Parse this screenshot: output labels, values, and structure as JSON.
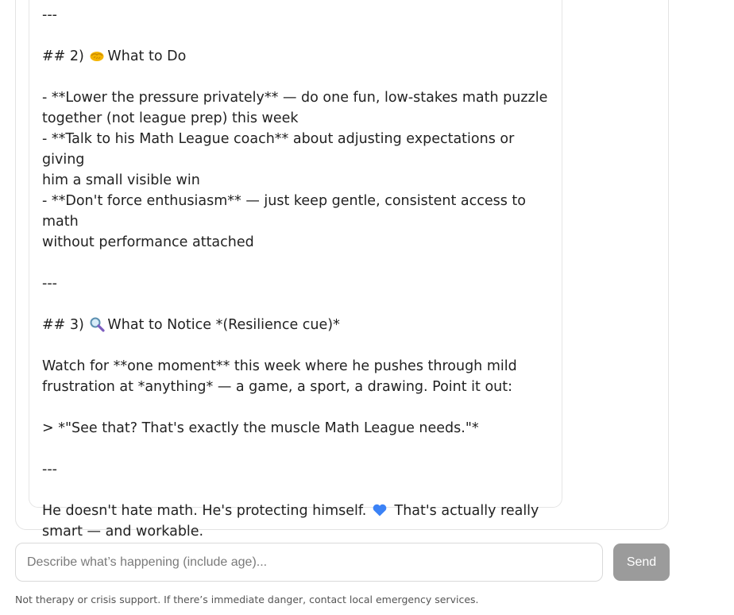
{
  "message": {
    "lines": [
      "---",
      "",
      "## 2) ",
      "What to Do",
      "",
      "- **Lower the pressure privately** — do one fun, low-stakes math puzzle",
      "together (not league prep) this week",
      "- **Talk to his Math League coach** about adjusting expectations or giving",
      "him a small visible win",
      "- **Don't force enthusiasm** — just keep gentle, consistent access to math",
      "without performance attached",
      "",
      "---",
      "",
      "## 3) ",
      "What to Notice *(Resilience cue)*",
      "",
      "Watch for **one moment** this week where he pushes through mild",
      "frustration at *anything* — a game, a sport, a drawing. Point it out:",
      "",
      "> *\"See that? That's exactly the muscle Math League needs.\"*",
      "",
      "---",
      "",
      "He doesn't hate math. He's protecting himself. ",
      "That's actually really",
      "smart — and workable."
    ],
    "icons": {
      "section2": "handshake-icon",
      "section3": "magnifying-glass-icon",
      "closing": "blue-heart-icon"
    }
  },
  "composer": {
    "placeholder": "Describe what’s happening (include age)...",
    "send_label": "Send"
  },
  "footer": {
    "disclaimer": "Not therapy or crisis support. If there’s immediate danger, contact local emergency services."
  },
  "colors": {
    "send_button": "#9b9b9b",
    "heart": "#3b82f6",
    "handshake": "#f4b400",
    "magnifier": "#7c5cbf"
  }
}
